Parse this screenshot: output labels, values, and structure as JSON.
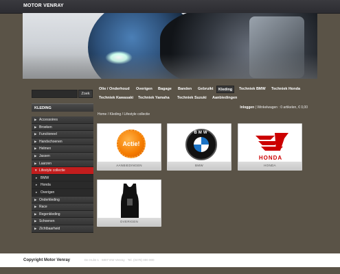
{
  "header": {
    "title": "MOTOR VENRAY"
  },
  "search": {
    "placeholder": "",
    "button_label": "Zoek"
  },
  "sidebar": {
    "heading": "KLEDING",
    "items": [
      {
        "label": "Accessoires",
        "type": "item",
        "active": false
      },
      {
        "label": "Broeken",
        "type": "item",
        "active": false
      },
      {
        "label": "Functioneel",
        "type": "item",
        "active": false
      },
      {
        "label": "Handschoenen",
        "type": "item",
        "active": false
      },
      {
        "label": "Helmen",
        "type": "item",
        "active": false
      },
      {
        "label": "Jassen",
        "type": "item",
        "active": false
      },
      {
        "label": "Laarzen",
        "type": "item",
        "active": false
      },
      {
        "label": "Lifestyle collectie",
        "type": "item",
        "active": true
      },
      {
        "label": "BMW",
        "type": "sub",
        "active": false
      },
      {
        "label": "Honda",
        "type": "sub",
        "active": false
      },
      {
        "label": "Overigen",
        "type": "sub",
        "active": false
      },
      {
        "label": "Onderkleding",
        "type": "item",
        "active": false
      },
      {
        "label": "Race",
        "type": "item",
        "active": false
      },
      {
        "label": "Regenkleding",
        "type": "item",
        "active": false
      },
      {
        "label": "Schoenen",
        "type": "item",
        "active": false
      },
      {
        "label": "Zichtbaarheid",
        "type": "item",
        "active": false
      }
    ]
  },
  "nav": {
    "row1": [
      "Olie / Onderhoud",
      "Overigen",
      "Bagage",
      "Banden",
      "Gebruikt",
      "Kleding",
      "Techniek BMW",
      "Techniek Honda"
    ],
    "row1_active": "Kleding",
    "row2": [
      "Techniek Kawasaki",
      "Techniek Yamaha",
      "Techniek Suzuki",
      "Aanbiedingen"
    ]
  },
  "account": {
    "login": "Inloggen",
    "cart": "Winkelwagen : 0 artikelen, € 0,00"
  },
  "breadcrumb": [
    "Home",
    "Kleding",
    "Lifestyle collectie"
  ],
  "products": [
    {
      "label": "AANBIEDINGEN",
      "badge": "Actie!"
    },
    {
      "label": "BMW",
      "logo_text": "BMW"
    },
    {
      "label": "HONDA",
      "logo_text": "HONDA"
    },
    {
      "label": "OVERIGEN"
    }
  ],
  "footer": {
    "copyright": "Copyright Motor Venray",
    "address": "De Hulst 1 · 5807 EW Venray · Tel. (0478) 000 000"
  },
  "colors": {
    "page_bg": "#5a5347",
    "accent_red": "#c21d1d",
    "header_bg": "#2c2c31"
  }
}
